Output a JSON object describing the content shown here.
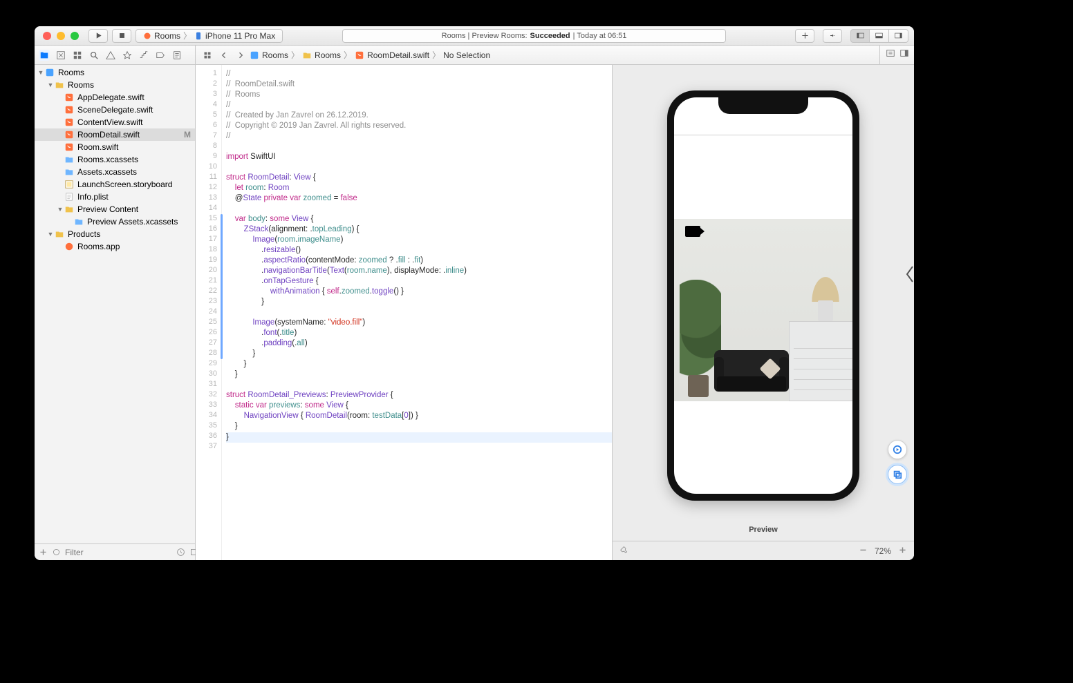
{
  "toolbar": {
    "scheme_project": "Rooms",
    "scheme_device": "iPhone 11 Pro Max",
    "activity_prefix": "Rooms | Preview Rooms: ",
    "activity_status": "Succeeded",
    "activity_suffix": " | Today at 06:51"
  },
  "jumpbar": {
    "items": [
      "Rooms",
      "Rooms",
      "RoomDetail.swift",
      "No Selection"
    ]
  },
  "sidebar": {
    "filter_placeholder": "Filter",
    "tree": [
      {
        "d": 0,
        "open": true,
        "icon": "proj",
        "label": "Rooms"
      },
      {
        "d": 1,
        "open": true,
        "icon": "folder",
        "label": "Rooms"
      },
      {
        "d": 2,
        "icon": "swift",
        "label": "AppDelegate.swift"
      },
      {
        "d": 2,
        "icon": "swift",
        "label": "SceneDelegate.swift"
      },
      {
        "d": 2,
        "icon": "swift",
        "label": "ContentView.swift"
      },
      {
        "d": 2,
        "icon": "swift",
        "label": "RoomDetail.swift",
        "sel": true,
        "badge": "M"
      },
      {
        "d": 2,
        "icon": "swift",
        "label": "Room.swift"
      },
      {
        "d": 2,
        "icon": "assets",
        "label": "Rooms.xcassets"
      },
      {
        "d": 2,
        "icon": "assets",
        "label": "Assets.xcassets"
      },
      {
        "d": 2,
        "icon": "storyboard",
        "label": "LaunchScreen.storyboard"
      },
      {
        "d": 2,
        "icon": "plist",
        "label": "Info.plist"
      },
      {
        "d": 2,
        "open": true,
        "icon": "folder",
        "label": "Preview Content"
      },
      {
        "d": 3,
        "icon": "assets",
        "label": "Preview Assets.xcassets"
      },
      {
        "d": 1,
        "open": true,
        "icon": "folder",
        "label": "Products"
      },
      {
        "d": 2,
        "icon": "app",
        "label": "Rooms.app"
      }
    ]
  },
  "code": {
    "lines": [
      {
        "n": 1,
        "h": "<span class='c-comment'>//</span>"
      },
      {
        "n": 2,
        "h": "<span class='c-comment'>//  RoomDetail.swift</span>"
      },
      {
        "n": 3,
        "h": "<span class='c-comment'>//  Rooms</span>"
      },
      {
        "n": 4,
        "h": "<span class='c-comment'>//</span>"
      },
      {
        "n": 5,
        "h": "<span class='c-comment'>//  Created by Jan Zavrel on 26.12.2019.</span>"
      },
      {
        "n": 6,
        "h": "<span class='c-comment'>//  Copyright © 2019 Jan Zavrel. All rights reserved.</span>"
      },
      {
        "n": 7,
        "h": "<span class='c-comment'>//</span>"
      },
      {
        "n": 8,
        "h": ""
      },
      {
        "n": 9,
        "h": "<span class='c-kw'>import</span> SwiftUI"
      },
      {
        "n": 10,
        "h": ""
      },
      {
        "n": 11,
        "h": "<span class='c-kw'>struct</span> <span class='c-type'>RoomDetail</span>: <span class='c-type'>View</span> {"
      },
      {
        "n": 12,
        "h": "    <span class='c-kw'>let</span> <span class='c-prop'>room</span>: <span class='c-type'>Room</span>"
      },
      {
        "n": 13,
        "h": "    @<span class='c-type'>State</span> <span class='c-kw'>private</span> <span class='c-kw'>var</span> <span class='c-prop'>zoomed</span> = <span class='c-kw'>false</span>"
      },
      {
        "n": 14,
        "h": ""
      },
      {
        "n": 15,
        "h": "    <span class='c-kw'>var</span> <span class='c-prop'>body</span>: <span class='c-kw'>some</span> <span class='c-type'>View</span> {"
      },
      {
        "n": 16,
        "h": "        <span class='c-type'>ZStack</span>(alignment: .<span class='c-prop'>topLeading</span>) {"
      },
      {
        "n": 17,
        "h": "            <span class='c-type'>Image</span>(<span class='c-prop'>room</span>.<span class='c-prop'>imageName</span>)"
      },
      {
        "n": 18,
        "h": "                .<span class='c-fn'>resizable</span>()"
      },
      {
        "n": 19,
        "h": "                .<span class='c-fn'>aspectRatio</span>(contentMode: <span class='c-prop'>zoomed</span> ? .<span class='c-prop'>fill</span> : .<span class='c-prop'>fit</span>)"
      },
      {
        "n": 20,
        "h": "                .<span class='c-fn'>navigationBarTitle</span>(<span class='c-type'>Text</span>(<span class='c-prop'>room</span>.<span class='c-prop'>name</span>), displayMode: .<span class='c-prop'>inline</span>)"
      },
      {
        "n": 21,
        "h": "                .<span class='c-fn'>onTapGesture</span> {"
      },
      {
        "n": 22,
        "h": "                    <span class='c-fn'>withAnimation</span> { <span class='c-kw'>self</span>.<span class='c-prop'>zoomed</span>.<span class='c-fn'>toggle</span>() }"
      },
      {
        "n": 23,
        "h": "                }"
      },
      {
        "n": 24,
        "h": ""
      },
      {
        "n": 25,
        "h": "            <span class='c-type'>Image</span>(systemName: <span class='c-str'>\"video.fill\"</span>)"
      },
      {
        "n": 26,
        "h": "                .<span class='c-fn'>font</span>(.<span class='c-prop'>title</span>)"
      },
      {
        "n": 27,
        "h": "                .<span class='c-fn'>padding</span>(.<span class='c-prop'>all</span>)"
      },
      {
        "n": 28,
        "h": "            }"
      },
      {
        "n": 29,
        "h": "        }"
      },
      {
        "n": 30,
        "h": "    }"
      },
      {
        "n": 31,
        "h": ""
      },
      {
        "n": 32,
        "h": "<span class='c-kw'>struct</span> <span class='c-type'>RoomDetail_Previews</span>: <span class='c-type'>PreviewProvider</span> {"
      },
      {
        "n": 33,
        "h": "    <span class='c-kw'>static</span> <span class='c-kw'>var</span> <span class='c-prop'>previews</span>: <span class='c-kw'>some</span> <span class='c-type'>View</span> {"
      },
      {
        "n": 34,
        "h": "        <span class='c-type'>NavigationView</span> { <span class='c-type'>RoomDetail</span>(room: <span class='c-prop'>testData</span>[<span class='c-num'>0</span>]) }"
      },
      {
        "n": 35,
        "h": "    }"
      },
      {
        "n": 36,
        "h": "}",
        "cur": true
      },
      {
        "n": 37,
        "h": ""
      }
    ],
    "changed_from": 15,
    "changed_to": 28
  },
  "preview": {
    "label": "Preview",
    "zoom": "72%"
  }
}
